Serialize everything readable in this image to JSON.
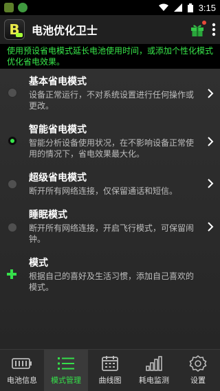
{
  "status_bar": {
    "time": "3:15"
  },
  "app_bar": {
    "logo_letter": "B",
    "title": "电池优化卫士"
  },
  "banner_text": "使用预设省电模式延长电池使用时间，或添加个性化模式优化省电效果。",
  "modes": [
    {
      "title": "基本省电模式",
      "desc": "设备正常运行，不对系统设置进行任何操作或更改。",
      "selected": false
    },
    {
      "title": "智能省电模式",
      "desc": "智能分析设备使用状况，在不影响设备正常使用的情况下，省电效果最大化。",
      "selected": true
    },
    {
      "title": "超级省电模式",
      "desc": "断开所有网络连接，仅保留通话和短信。",
      "selected": false
    },
    {
      "title": "睡眠模式",
      "desc": "断开所有网络连接，开启飞行模式，可保留闹钟。",
      "selected": false
    },
    {
      "title": "模式",
      "desc": "根据自己的喜好及生活习惯，添加自己喜欢的模式。"
    }
  ],
  "bottom_nav": [
    {
      "label": "电池信息",
      "icon": "battery-icon"
    },
    {
      "label": "模式管理",
      "icon": "list-icon",
      "active": true
    },
    {
      "label": "曲线图",
      "icon": "calendar-icon"
    },
    {
      "label": "耗电监测",
      "icon": "bar-chart-icon"
    },
    {
      "label": "设置",
      "icon": "gear-icon"
    }
  ],
  "colors": {
    "accent": "#35e04a",
    "banner_text": "#38e74a",
    "badge_red": "#e64a3a"
  }
}
